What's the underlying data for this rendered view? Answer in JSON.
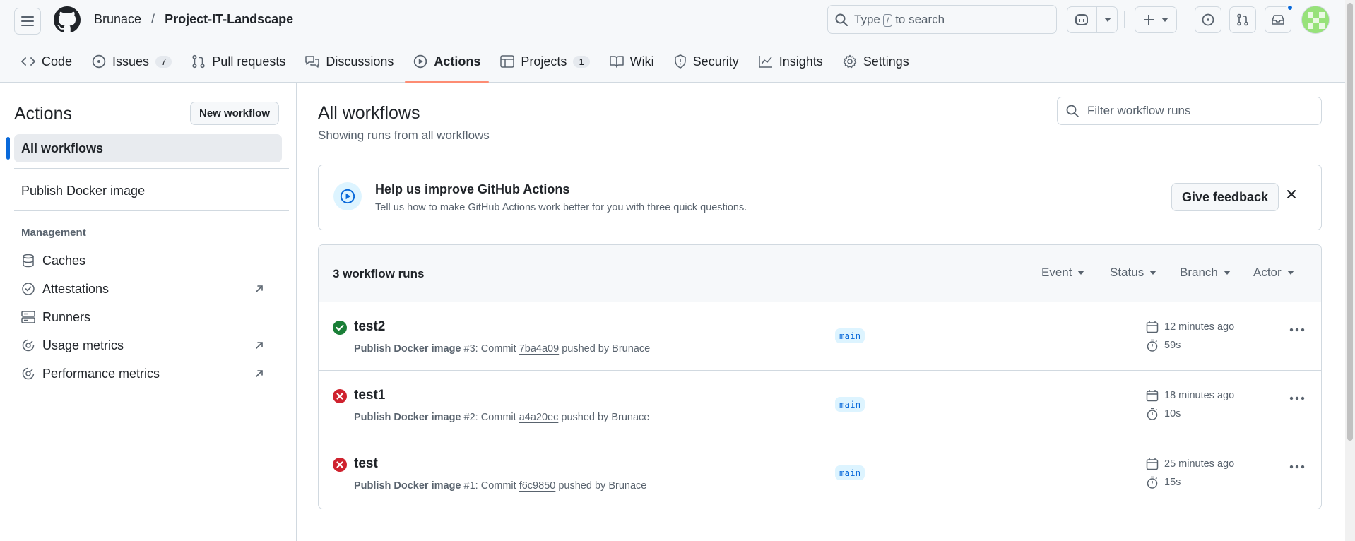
{
  "header": {
    "owner": "Brunace",
    "separator": "/",
    "repo": "Project-IT-Landscape",
    "search": {
      "prefix": "Type",
      "key": "/",
      "suffix": "to search"
    }
  },
  "tabs": [
    {
      "label": "Code",
      "icon": "code-icon"
    },
    {
      "label": "Issues",
      "count": "7",
      "icon": "issue-opened-icon"
    },
    {
      "label": "Pull requests",
      "icon": "git-pull-request-icon"
    },
    {
      "label": "Discussions",
      "icon": "comment-discussion-icon"
    },
    {
      "label": "Actions",
      "icon": "play-icon",
      "active": true
    },
    {
      "label": "Projects",
      "count": "1",
      "icon": "table-icon"
    },
    {
      "label": "Wiki",
      "icon": "book-icon"
    },
    {
      "label": "Security",
      "icon": "shield-icon"
    },
    {
      "label": "Insights",
      "icon": "graph-icon"
    },
    {
      "label": "Settings",
      "icon": "gear-icon"
    }
  ],
  "sidebar": {
    "title": "Actions",
    "new_workflow": "New workflow",
    "all_workflows": "All workflows",
    "workflows": [
      "Publish Docker image"
    ],
    "management_label": "Management",
    "management": [
      {
        "label": "Caches",
        "icon": "database-icon",
        "external": false
      },
      {
        "label": "Attestations",
        "icon": "verified-icon",
        "external": true
      },
      {
        "label": "Runners",
        "icon": "server-icon",
        "external": false
      },
      {
        "label": "Usage metrics",
        "icon": "meter-icon",
        "external": true
      },
      {
        "label": "Performance metrics",
        "icon": "meter-icon",
        "external": true
      }
    ]
  },
  "main": {
    "title": "All workflows",
    "subtitle": "Showing runs from all workflows",
    "filter_placeholder": "Filter workflow runs"
  },
  "banner": {
    "title": "Help us improve GitHub Actions",
    "text": "Tell us how to make GitHub Actions work better for you with three quick questions.",
    "button": "Give feedback"
  },
  "runs": {
    "count_label": "3 workflow runs",
    "filters": [
      "Event",
      "Status",
      "Branch",
      "Actor"
    ],
    "items": [
      {
        "title": "test2",
        "status": "success",
        "workflow": "Publish Docker image",
        "number": "#3",
        "sha": "7ba4a09",
        "by": "Brunace",
        "branch": "main",
        "when": "12 minutes ago",
        "duration": "59s"
      },
      {
        "title": "test1",
        "status": "failure",
        "workflow": "Publish Docker image",
        "number": "#2",
        "sha": "a4a20ec",
        "by": "Brunace",
        "branch": "main",
        "when": "18 minutes ago",
        "duration": "10s"
      },
      {
        "title": "test",
        "status": "failure",
        "workflow": "Publish Docker image",
        "number": "#1",
        "sha": "f6c9850",
        "by": "Brunace",
        "branch": "main",
        "when": "25 minutes ago",
        "duration": "15s"
      }
    ],
    "text": {
      "commit": "Commit",
      "pushed_by": "pushed by"
    }
  },
  "colors": {
    "accent": "#0969da",
    "success": "#1a7f37",
    "failure": "#cf222e",
    "tab_underline": "#fd8c73",
    "border": "#d1d9e0",
    "muted": "#59636e"
  }
}
